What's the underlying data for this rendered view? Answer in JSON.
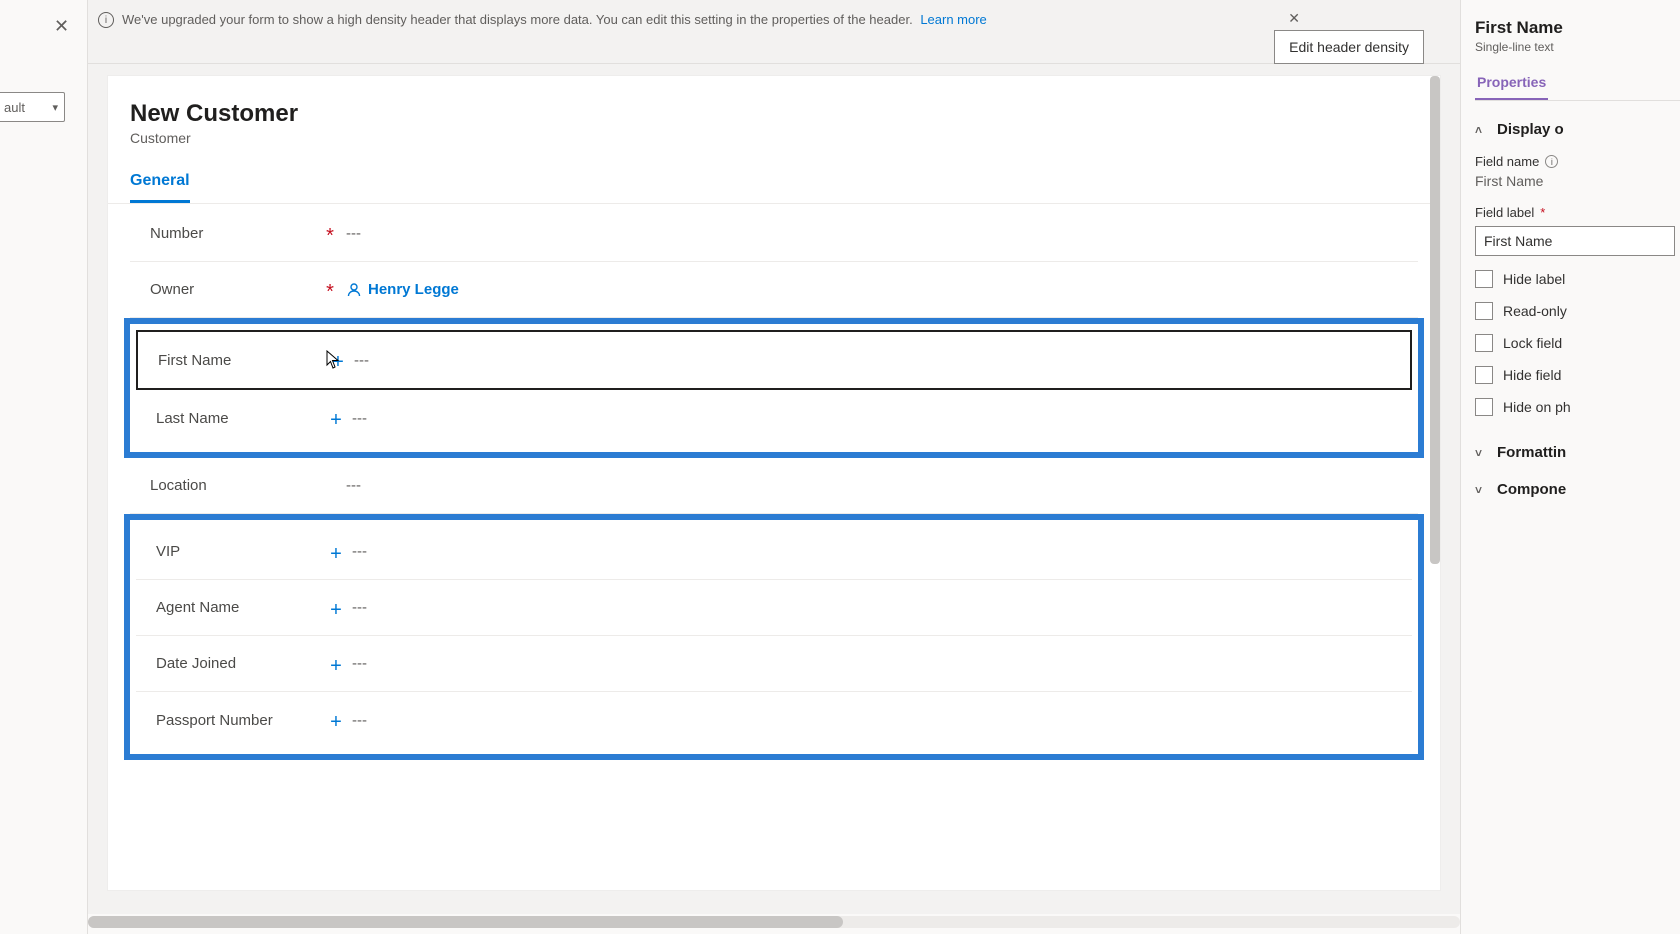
{
  "leftSliver": {
    "dropdown_value": "ault"
  },
  "notification": {
    "text": "We've upgraded your form to show a high density header that displays more data. You can edit this setting in the properties of the header.",
    "link": "Learn more",
    "button": "Edit header density"
  },
  "form": {
    "title": "New Customer",
    "subtitle": "Customer",
    "tab": "General",
    "empty": "---",
    "owner_name": "Henry Legge",
    "fields": {
      "number": "Number",
      "owner": "Owner",
      "first_name": "First Name",
      "last_name": "Last Name",
      "location": "Location",
      "vip": "VIP",
      "agent_name": "Agent Name",
      "date_joined": "Date Joined",
      "passport_number": "Passport Number"
    }
  },
  "rightPanel": {
    "title": "First Name",
    "type": "Single-line text",
    "tab": "Properties",
    "sections": {
      "display": "Display o",
      "formatting": "Formattin",
      "components": "Compone"
    },
    "field_name_label": "Field name",
    "field_name_value": "First Name",
    "field_label_label": "Field label",
    "field_label_value": "First Name",
    "checks": {
      "hide_label": "Hide label",
      "read_only": "Read-only",
      "lock_field": "Lock field",
      "hide_field": "Hide field",
      "hide_on_phone": "Hide on ph"
    }
  }
}
